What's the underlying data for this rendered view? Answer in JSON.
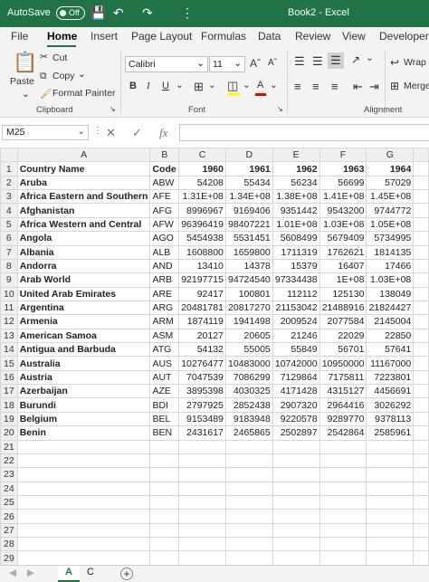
{
  "title": {
    "autosave": "AutoSave",
    "autosave_state": "Off",
    "document": "Book2 - Excel"
  },
  "tabs": [
    "File",
    "Home",
    "Insert",
    "Page Layout",
    "Formulas",
    "Data",
    "Review",
    "View",
    "Developer"
  ],
  "ribbon": {
    "paste": "Paste",
    "cut": "Cut",
    "copy": "Copy",
    "format_painter": "Format Painter",
    "font_name": "Calibri",
    "font_size": "11",
    "wrap": "Wrap",
    "merge": "Merge",
    "groups": {
      "clipboard": "Clipboard",
      "font": "Font",
      "alignment": "Alignment"
    }
  },
  "formula_bar": {
    "name_box": "M25",
    "formula": ""
  },
  "sheet": {
    "columns": [
      "",
      "A",
      "B",
      "C",
      "D",
      "E",
      "F",
      "G"
    ],
    "header_row": [
      "Country Name",
      "Code",
      "1960",
      "1961",
      "1962",
      "1963",
      "1964"
    ],
    "rows": [
      [
        "Aruba",
        "ABW",
        "54208",
        "55434",
        "56234",
        "56699",
        "57029"
      ],
      [
        "Africa Eastern and Southern",
        "AFE",
        "1.31E+08",
        "1.34E+08",
        "1.38E+08",
        "1.41E+08",
        "1.45E+08"
      ],
      [
        "Afghanistan",
        "AFG",
        "8996967",
        "9169406",
        "9351442",
        "9543200",
        "9744772"
      ],
      [
        "Africa Western and Central",
        "AFW",
        "96396419",
        "98407221",
        "1.01E+08",
        "1.03E+08",
        "1.05E+08"
      ],
      [
        "Angola",
        "AGO",
        "5454938",
        "5531451",
        "5608499",
        "5679409",
        "5734995"
      ],
      [
        "Albania",
        "ALB",
        "1608800",
        "1659800",
        "1711319",
        "1762621",
        "1814135"
      ],
      [
        "Andorra",
        "AND",
        "13410",
        "14378",
        "15379",
        "16407",
        "17466"
      ],
      [
        "Arab World",
        "ARB",
        "92197715",
        "94724540",
        "97334438",
        "1E+08",
        "1.03E+08"
      ],
      [
        "United Arab Emirates",
        "ARE",
        "92417",
        "100801",
        "112112",
        "125130",
        "138049"
      ],
      [
        "Argentina",
        "ARG",
        "20481781",
        "20817270",
        "21153042",
        "21488916",
        "21824427"
      ],
      [
        "Armenia",
        "ARM",
        "1874119",
        "1941498",
        "2009524",
        "2077584",
        "2145004"
      ],
      [
        "American Samoa",
        "ASM",
        "20127",
        "20605",
        "21246",
        "22029",
        "22850"
      ],
      [
        "Antigua and Barbuda",
        "ATG",
        "54132",
        "55005",
        "55849",
        "56701",
        "57641"
      ],
      [
        "Australia",
        "AUS",
        "10276477",
        "10483000",
        "10742000",
        "10950000",
        "11167000"
      ],
      [
        "Austria",
        "AUT",
        "7047539",
        "7086299",
        "7129864",
        "7175811",
        "7223801"
      ],
      [
        "Azerbaijan",
        "AZE",
        "3895398",
        "4030325",
        "4171428",
        "4315127",
        "4456691"
      ],
      [
        "Burundi",
        "BDI",
        "2797925",
        "2852438",
        "2907320",
        "2964416",
        "3026292"
      ],
      [
        "Belgium",
        "BEL",
        "9153489",
        "9183948",
        "9220578",
        "9289770",
        "9378113"
      ],
      [
        "Benin",
        "BEN",
        "2431617",
        "2465865",
        "2502897",
        "2542864",
        "2585961"
      ]
    ],
    "empty_row_numbers": [
      "21",
      "22",
      "23",
      "24",
      "25",
      "26",
      "27",
      "28",
      "29"
    ]
  },
  "sheet_tabs": [
    "A",
    "C"
  ],
  "colors": {
    "brand": "#217346"
  }
}
